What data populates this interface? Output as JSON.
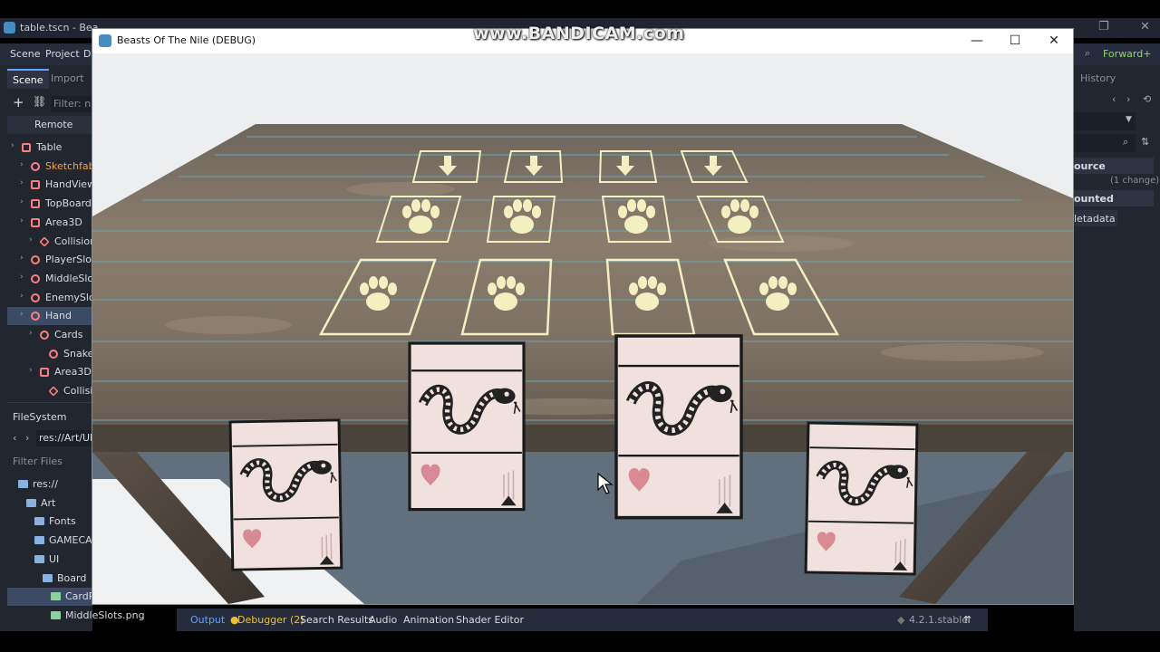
{
  "editor": {
    "title": "table.tscn - Bea",
    "menu": [
      "Scene",
      "Project",
      "De"
    ],
    "left_tabs": [
      "Scene",
      "Import"
    ],
    "filter_placeholder": "Filter: na",
    "remote_label": "Remote",
    "scene_tree": [
      {
        "label": "Table",
        "indent": 0
      },
      {
        "label": "Sketchfab_m",
        "indent": 1
      },
      {
        "label": "HandView",
        "indent": 1
      },
      {
        "label": "TopBoardVi",
        "indent": 1
      },
      {
        "label": "Area3D",
        "indent": 1
      },
      {
        "label": "CollisionS",
        "indent": 2
      },
      {
        "label": "PlayerSlots",
        "indent": 1
      },
      {
        "label": "MiddleSlots",
        "indent": 1
      },
      {
        "label": "EnemySlots",
        "indent": 1
      },
      {
        "label": "Hand",
        "indent": 1
      },
      {
        "label": "Cards",
        "indent": 2
      },
      {
        "label": "Snake",
        "indent": 3
      },
      {
        "label": "Area3D",
        "indent": 2
      },
      {
        "label": "Collision",
        "indent": 3
      }
    ],
    "filesystem_title": "FileSystem",
    "path": "res://Art/UI/B",
    "filter_files": "Filter Files",
    "files": [
      {
        "label": "res://",
        "indent": 0
      },
      {
        "label": "Art",
        "indent": 1
      },
      {
        "label": "Fonts",
        "indent": 2
      },
      {
        "label": "GAMECAR",
        "indent": 2
      },
      {
        "label": "UI",
        "indent": 2
      },
      {
        "label": "Board",
        "indent": 3
      },
      {
        "label": "CardP",
        "indent": 4
      },
      {
        "label": "MiddleSlots.png",
        "indent": 4
      }
    ],
    "right_panel": {
      "renderer": "Forward+",
      "history_tab": "History",
      "source_label": "ource",
      "changes": "(1 change)",
      "mounted": "ounted",
      "metadata": "letadata"
    },
    "bottom_tabs": [
      "Output",
      "Debugger (2)",
      "Search Results",
      "Audio",
      "Animation",
      "Shader Editor"
    ],
    "version": "4.2.1.stable",
    "window_controls": [
      "—",
      "❐",
      "✕"
    ]
  },
  "watermark": "www.BANDICAM.com",
  "game_window": {
    "title": "Beasts Of The Nile (DEBUG)",
    "controls": [
      "—",
      "☐",
      "✕"
    ]
  },
  "colors": {
    "accent": "#5fa2ff",
    "node_red": "#fc7f7f",
    "slot_outline": "#f3efc0",
    "card_bg": "#f0e0de",
    "heart": "#d78a93"
  },
  "board": {
    "slot_rows": [
      {
        "name": "enemy-slots",
        "icon": "arrow-down",
        "count": 4
      },
      {
        "name": "middle-slots",
        "icon": "paw",
        "count": 4
      },
      {
        "name": "player-slots",
        "icon": "paw",
        "count": 4
      }
    ],
    "hand_cards": [
      {
        "name": "Snake",
        "icon": "snake"
      },
      {
        "name": "Snake",
        "icon": "snake"
      },
      {
        "name": "Snake",
        "icon": "snake"
      },
      {
        "name": "Snake",
        "icon": "snake"
      }
    ]
  }
}
